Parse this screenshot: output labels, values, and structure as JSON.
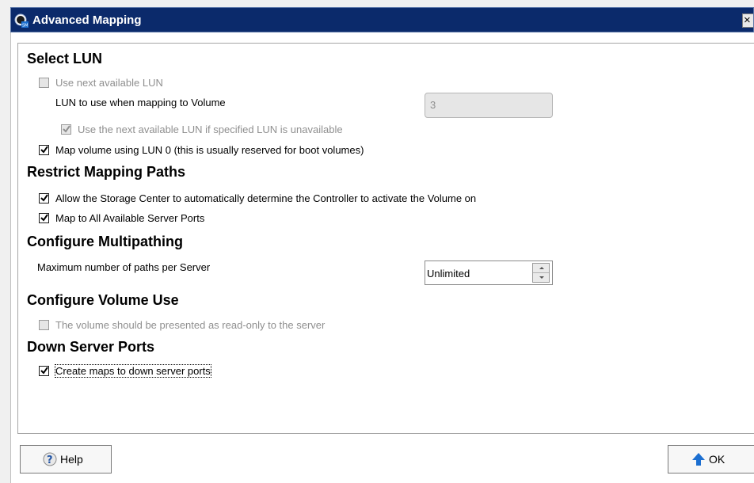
{
  "window": {
    "title": "Advanced Mapping",
    "close_glyph": "×",
    "icon": "dell-sm-app-icon"
  },
  "select_lun": {
    "title": "Select LUN",
    "use_next_available": {
      "label": "Use next available LUN",
      "checked": false,
      "enabled": false
    },
    "lun_to_use_label": "LUN to use when mapping to Volume",
    "lun_value": "3",
    "use_next_if_unavailable": {
      "label": "Use the next available LUN if specified LUN is unavailable",
      "checked": true,
      "enabled": false
    },
    "map_lun0": {
      "label": "Map volume using LUN 0 (this is usually reserved for boot volumes)",
      "checked": true,
      "enabled": true
    }
  },
  "restrict_paths": {
    "title": "Restrict Mapping Paths",
    "auto_controller": {
      "label": "Allow the Storage Center to automatically determine the Controller to activate the Volume on",
      "checked": true
    },
    "all_ports": {
      "label": "Map to All Available Server Ports",
      "checked": true
    }
  },
  "multipathing": {
    "title": "Configure Multipathing",
    "max_paths_label": "Maximum number of paths per Server",
    "max_paths_value": "Unlimited"
  },
  "volume_use": {
    "title": "Configure Volume Use",
    "read_only": {
      "label": "The volume should be presented as read-only to the server",
      "checked": false,
      "enabled": false
    }
  },
  "down_ports": {
    "title": "Down Server Ports",
    "create_maps": {
      "label": "Create maps to down server ports",
      "checked": true
    }
  },
  "buttons": {
    "help_label": "Help",
    "ok_label": "OK"
  },
  "colors": {
    "titlebar": "#0b2a6b",
    "accent_arrow": "#1c6fd1",
    "disabled_text": "#8f8f8f"
  }
}
